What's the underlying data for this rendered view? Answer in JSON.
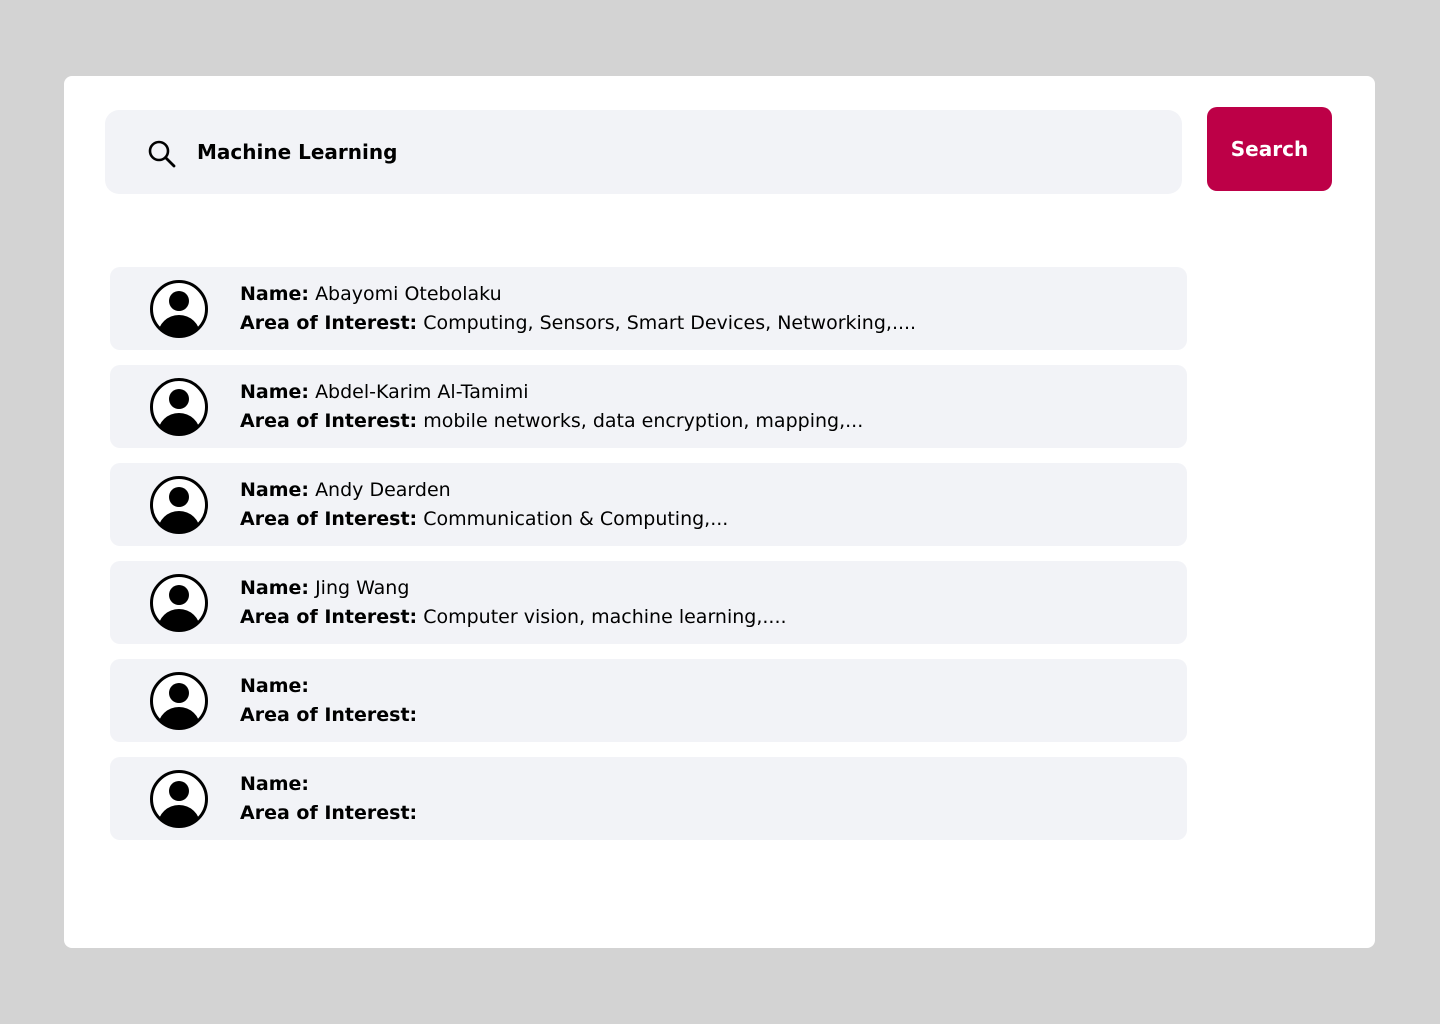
{
  "search": {
    "value": "Machine Learning",
    "button_label": "Search"
  },
  "labels": {
    "name": "Name:",
    "area": "Area of Interest:"
  },
  "results": [
    {
      "name": "Abayomi Otebolaku",
      "area": "Computing, Sensors, Smart Devices, Networking,...."
    },
    {
      "name": "Abdel-Karim Al-Tamimi",
      "area": "mobile networks, data encryption, mapping,..."
    },
    {
      "name": "Andy Dearden",
      "area": "Communication & Computing,..."
    },
    {
      "name": "Jing Wang",
      "area": "Computer vision, machine learning,...."
    },
    {
      "name": "",
      "area": ""
    },
    {
      "name": "",
      "area": ""
    }
  ],
  "colors": {
    "accent": "#bd0047",
    "row_bg": "#f2f3f7",
    "page_bg": "#d3d3d3"
  },
  "icons": {
    "search": "search-icon",
    "avatar": "user-avatar-icon"
  }
}
